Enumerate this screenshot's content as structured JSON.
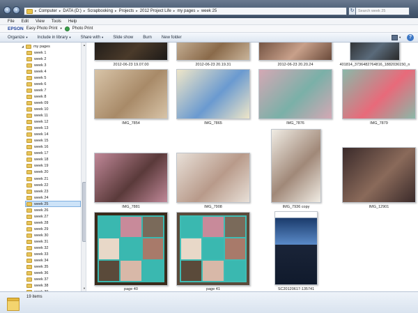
{
  "address_bar": {
    "crumbs": [
      "Computer",
      "DATA (D:)",
      "Scrapbooking",
      "Projects",
      "2012 Project Life",
      "my pages",
      "week 25"
    ]
  },
  "search": {
    "placeholder": "Search week 25"
  },
  "menu": [
    "File",
    "Edit",
    "View",
    "Tools",
    "Help"
  ],
  "epson": {
    "logo": "EPSON",
    "easy_print": "Easy Photo Print",
    "photo_print": "Photo Print"
  },
  "commands": {
    "organize": "Organize",
    "include_in_library": "Include in library",
    "share_with": "Share with",
    "slide_show": "Slide show",
    "burn": "Burn",
    "new_folder": "New folder"
  },
  "sidebar": {
    "parent": "my pages",
    "items": [
      "week 1",
      "week 2",
      "week 3",
      "week 4",
      "week 5",
      "week 6",
      "week 7",
      "week 8",
      "week 09",
      "week 10",
      "week 11",
      "week 12",
      "week 13",
      "week 14",
      "week 15",
      "week 16",
      "week 17",
      "week 18",
      "week 19",
      "week 20",
      "week 21",
      "week 22",
      "week 23",
      "week 24",
      "week 25",
      "week 26",
      "week 27",
      "week 28",
      "week 29",
      "week 30",
      "week 31",
      "week 32",
      "week 33",
      "week 34",
      "week 35",
      "week 36",
      "week 37",
      "week 38",
      "week 39"
    ],
    "selected": "week 25"
  },
  "files": [
    {
      "name": "2012-06-23 19.07.00",
      "colors": [
        "#1d1a18",
        "#4a3a2a"
      ]
    },
    {
      "name": "2012-06-23 20.19.31",
      "colors": [
        "#c9b49a",
        "#8a6a4a"
      ]
    },
    {
      "name": "2012-06-23 20.20.24",
      "colors": [
        "#6a4a3a",
        "#c8a08a"
      ]
    },
    {
      "name": "401814_3736482764816_1882036150_n",
      "colors": [
        "#2a2a2a",
        "#5a6a7a"
      ]
    },
    {
      "name": "IMG_7854",
      "colors": [
        "#d8c4a8",
        "#a88a68"
      ]
    },
    {
      "name": "IMG_7865",
      "colors": [
        "#efe6c8",
        "#6a9ad0"
      ]
    },
    {
      "name": "IMG_7876",
      "colors": [
        "#d4a8b4",
        "#7ab0a8"
      ]
    },
    {
      "name": "IMG_7879",
      "colors": [
        "#8ab8a8",
        "#e86a7a"
      ]
    },
    {
      "name": "IMG_7881",
      "colors": [
        "#c08898",
        "#5a3a3a"
      ]
    },
    {
      "name": "IMG_7908",
      "colors": [
        "#e8e0d8",
        "#b89a8a"
      ]
    },
    {
      "name": "IMG_7936 copy",
      "colors": [
        "#f0ece4",
        "#a08878"
      ]
    },
    {
      "name": "IMG_12901",
      "colors": [
        "#3a2a2a",
        "#8a6a5a"
      ]
    },
    {
      "name": "page 40",
      "colors": [
        "#3ab8b0",
        "#3a2a1a"
      ]
    },
    {
      "name": "page 41",
      "colors": [
        "#40bcb4",
        "#5a4a3a"
      ]
    },
    {
      "name": "SC20120617-135741",
      "colors": [
        "#1a3a6a",
        "#5a8ac8"
      ]
    }
  ],
  "status": {
    "item_count": "19 items"
  }
}
